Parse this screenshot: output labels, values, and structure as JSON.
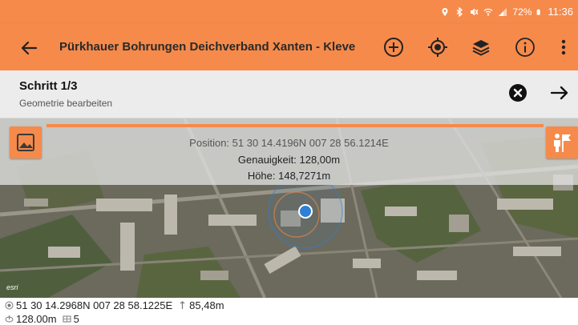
{
  "status": {
    "battery": "72%",
    "time": "11:36"
  },
  "appbar": {
    "title": "Pürkhauer Bohrungen Deichverband Xanten - Kleve"
  },
  "step": {
    "title": "Schritt 1/3",
    "subtitle": "Geometrie bearbeiten"
  },
  "map": {
    "position": "Position: 51 30 14.4196N 007 28 56.1214E",
    "accuracy": "Genauigkeit: 128,00m",
    "altitude": "Höhe: 148,7271m",
    "attribution": "esri"
  },
  "footer": {
    "coords": "51 30 14.2968N 007 28 58.1225E",
    "altitude": "85,48m",
    "accuracy": "128.00m",
    "satellites": "5"
  },
  "colors": {
    "accent": "#f58a4b",
    "location_dot": "#2f7fd6"
  }
}
